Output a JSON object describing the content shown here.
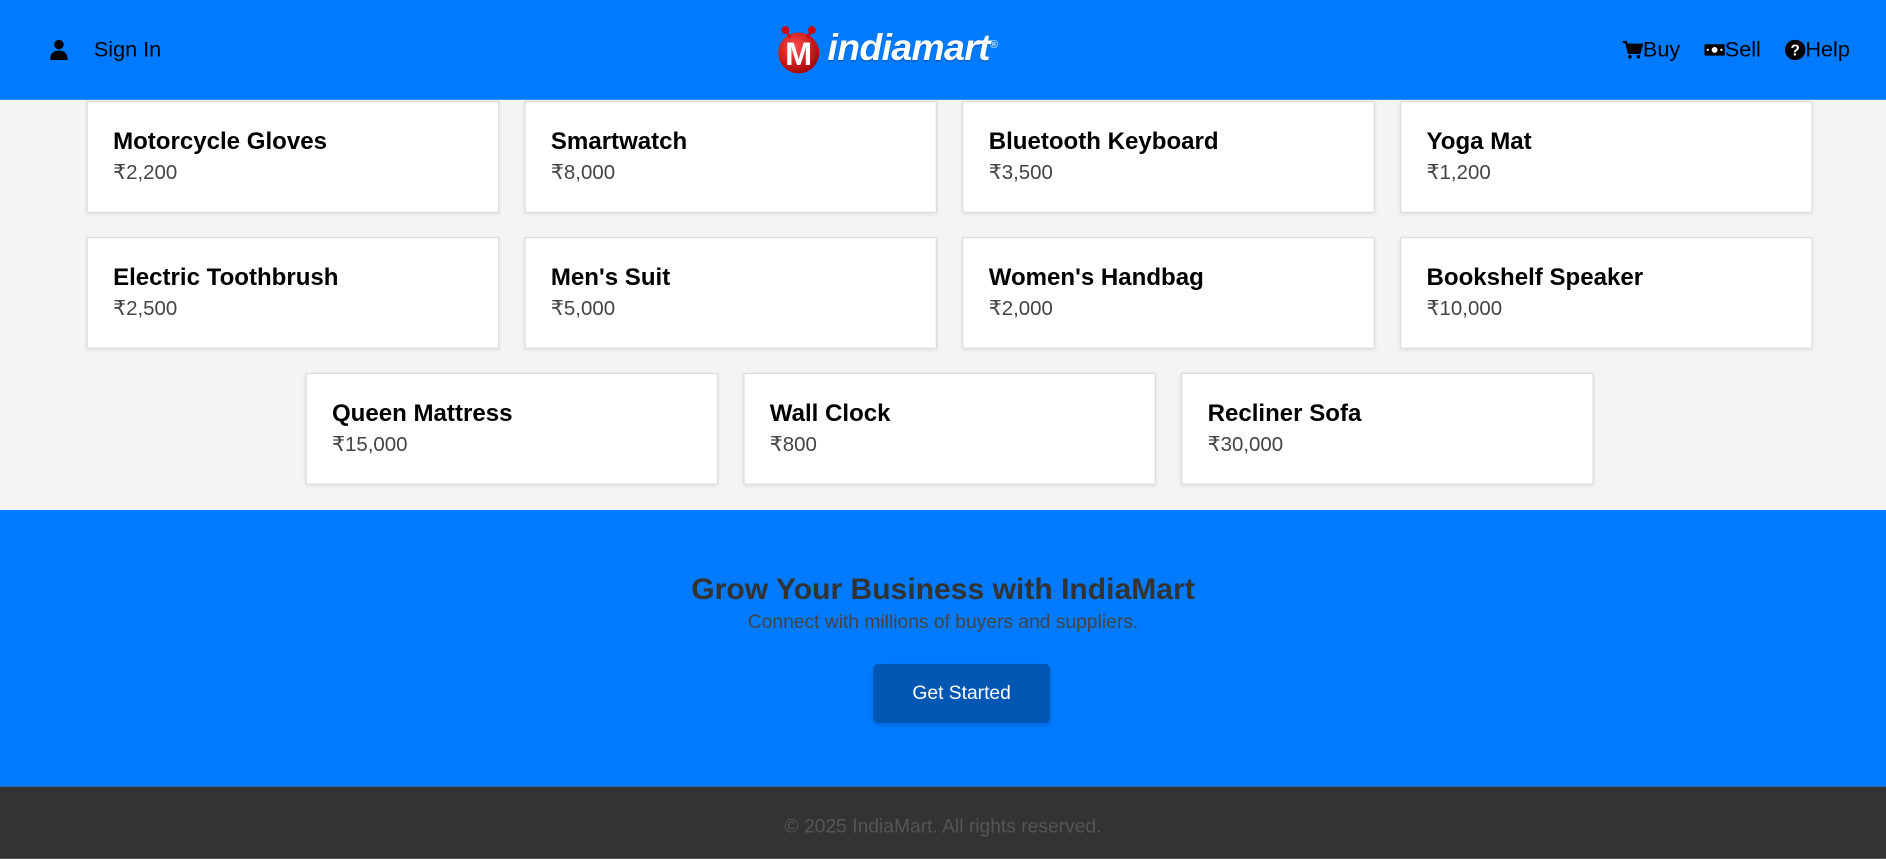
{
  "header": {
    "signin_label": "Sign In",
    "logo_text": "indiamart",
    "logo_mark": "M",
    "nav": [
      {
        "label": "Buy",
        "icon": "cart-icon"
      },
      {
        "label": "Sell",
        "icon": "money-icon"
      },
      {
        "label": "Help",
        "icon": "question-circle-icon"
      }
    ],
    "bg_color": "#007bff"
  },
  "products": [
    {
      "name": "Motorcycle Gloves",
      "price": "₹2,200"
    },
    {
      "name": "Smartwatch",
      "price": "₹8,000"
    },
    {
      "name": "Bluetooth Keyboard",
      "price": "₹3,500"
    },
    {
      "name": "Yoga Mat",
      "price": "₹1,200"
    },
    {
      "name": "Electric Toothbrush",
      "price": "₹2,500"
    },
    {
      "name": "Men's Suit",
      "price": "₹5,000"
    },
    {
      "name": "Women's Handbag",
      "price": "₹2,000"
    },
    {
      "name": "Bookshelf Speaker",
      "price": "₹10,000"
    },
    {
      "name": "Queen Mattress",
      "price": "₹15,000"
    },
    {
      "name": "Wall Clock",
      "price": "₹800"
    },
    {
      "name": "Recliner Sofa",
      "price": "₹30,000"
    }
  ],
  "cta": {
    "title": "Grow Your Business with IndiaMart",
    "subtitle": "Connect with millions of buyers and suppliers.",
    "button_label": "Get Started",
    "button_color": "#0056b3"
  },
  "footer": {
    "copyright": "© 2025 IndiaMart. All rights reserved."
  }
}
